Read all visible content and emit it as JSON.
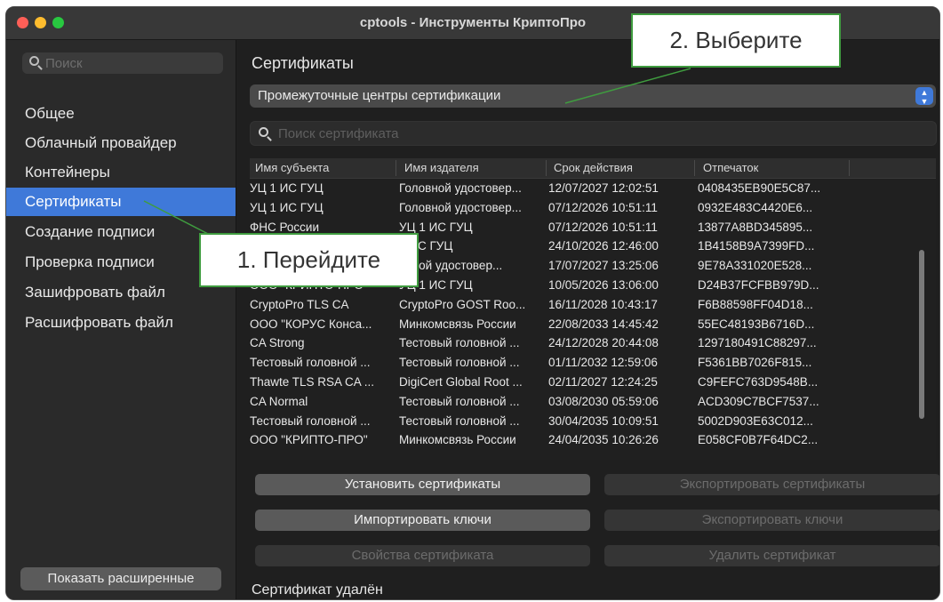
{
  "window": {
    "title": "cptools - Инструменты КриптоПро"
  },
  "sidebar": {
    "search_placeholder": "Поиск",
    "items": [
      {
        "label": "Общее"
      },
      {
        "label": "Облачный провайдер"
      },
      {
        "label": "Контейнеры"
      },
      {
        "label": "Сертификаты"
      },
      {
        "label": "Создание подписи"
      },
      {
        "label": "Проверка подписи"
      },
      {
        "label": "Зашифровать файл"
      },
      {
        "label": "Расшифровать файл"
      }
    ],
    "show_advanced": "Показать расширенные"
  },
  "main": {
    "section_title": "Сертификаты",
    "store_selected": "Промежуточные центры сертификации",
    "search_placeholder": "Поиск сертификата",
    "columns": [
      "Имя субъекта",
      "Имя издателя",
      "Срок действия",
      "Отпечаток"
    ],
    "rows": [
      [
        "УЦ 1 ИС ГУЦ",
        "Головной удостовер...",
        "12/07/2027 12:02:51",
        "0408435EB90E5C87..."
      ],
      [
        "УЦ 1 ИС ГУЦ",
        "Головной удостовер...",
        "07/12/2026 10:51:11",
        "0932E483C4420E6..."
      ],
      [
        "ФНС России",
        "УЦ 1 ИС ГУЦ",
        "07/12/2026 10:51:11",
        "13877A8BD345895..."
      ],
      [
        "",
        "1 ИС ГУЦ",
        "24/10/2026 12:46:00",
        "1B4158B9A7399FD..."
      ],
      [
        "",
        "овной удостовер...",
        "17/07/2027 13:25:06",
        "9E78A331020E528..."
      ],
      [
        "ООО \"КРИПТО-ПРО\"",
        "УЦ 1 ИС ГУЦ",
        "10/05/2026 13:06:00",
        "D24B37FCFBB979D..."
      ],
      [
        "CryptoPro TLS CA",
        "CryptoPro GOST Roo...",
        "16/11/2028 10:43:17",
        "F6B88598FF04D18..."
      ],
      [
        "ООО \"КОРУС Конса...",
        "Минкомсвязь России",
        "22/08/2033 14:45:42",
        "55EC48193B6716D..."
      ],
      [
        "CA Strong",
        "Тестовый головной ...",
        "24/12/2028 20:44:08",
        "1297180491C88297..."
      ],
      [
        "Тестовый головной ...",
        "Тестовый головной ...",
        "01/11/2032 12:59:06",
        "F5361BB7026F815..."
      ],
      [
        "Thawte TLS RSA CA ...",
        "DigiCert Global Root ...",
        "02/11/2027 12:24:25",
        "C9FEFC763D9548B..."
      ],
      [
        "CA Normal",
        "Тестовый головной ...",
        "03/08/2030 05:59:06",
        "ACD309C7BCF7537..."
      ],
      [
        "Тестовый головной ...",
        "Тестовый головной ...",
        "30/04/2035 10:09:51",
        "5002D903E63C012..."
      ],
      [
        "ООО \"КРИПТО-ПРО\"",
        "Минкомсвязь России",
        "24/04/2035 10:26:26",
        "E058CF0B7F64DC2..."
      ]
    ],
    "buttons": {
      "install": "Установить сертификаты",
      "export": "Экспортировать сертификаты",
      "import_keys": "Импортировать ключи",
      "export_keys": "Экспортировать ключи",
      "properties": "Свойства сертификата",
      "delete": "Удалить сертификат"
    },
    "status": "Сертификат удалён"
  },
  "callouts": {
    "step1": "1. Перейдите",
    "step2": "2. Выберите"
  },
  "colors": {
    "accent": "#3f79d9",
    "callout_border": "#3f9c3f"
  }
}
